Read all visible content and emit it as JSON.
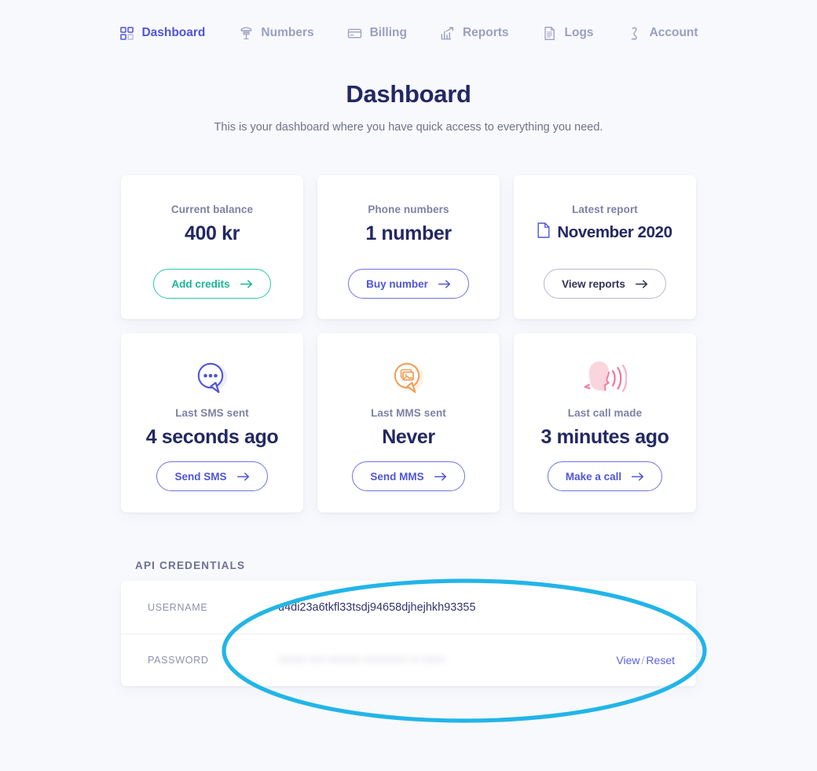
{
  "nav": {
    "items": [
      {
        "label": "Dashboard",
        "icon": "grid-icon",
        "active": true
      },
      {
        "label": "Numbers",
        "icon": "phone-icon",
        "active": false
      },
      {
        "label": "Billing",
        "icon": "card-icon",
        "active": false
      },
      {
        "label": "Reports",
        "icon": "chart-icon",
        "active": false
      },
      {
        "label": "Logs",
        "icon": "document-icon",
        "active": false
      },
      {
        "label": "Account",
        "icon": "person-icon",
        "active": false
      }
    ]
  },
  "header": {
    "title": "Dashboard",
    "subtitle": "This is your dashboard where you have quick access to everything you need."
  },
  "cards_row1": [
    {
      "label": "Current balance",
      "value": "400 kr",
      "button": "Add credits",
      "button_style": "green",
      "icon": null
    },
    {
      "label": "Phone numbers",
      "value": "1 number",
      "button": "Buy number",
      "button_style": "indigo",
      "icon": null
    },
    {
      "label": "Latest report",
      "value": "November 2020",
      "button": "View reports",
      "button_style": "grey",
      "icon": "file-icon"
    }
  ],
  "cards_row2": [
    {
      "illustration": "speech-bubble-dots-icon",
      "label": "Last SMS sent",
      "value": "4 seconds ago",
      "button": "Send SMS",
      "button_style": "indigo"
    },
    {
      "illustration": "speech-bubble-image-icon",
      "label": "Last MMS sent",
      "value": "Never",
      "button": "Send MMS",
      "button_style": "indigo"
    },
    {
      "illustration": "speaking-head-icon",
      "label": "Last call made",
      "value": "3 minutes ago",
      "button": "Make a call",
      "button_style": "indigo"
    }
  ],
  "credentials": {
    "section_title": "API CREDENTIALS",
    "username_label": "USERNAME",
    "username_value": "u4di23a6tkfl33tsdj94658djhejhkh93355",
    "password_label": "PASSWORD",
    "password_value": "••••••• •••• •••••••• ••••••••••• •• ••••••",
    "view_label": "View",
    "separator": "/",
    "reset_label": "Reset"
  },
  "colors": {
    "background": "#f8f9fd",
    "card": "#ffffff",
    "title": "#232863",
    "accent_indigo": "#4f55d9",
    "accent_green": "#18b894",
    "accent_orange": "#f0a05a",
    "accent_pink": "#f58ba8",
    "muted": "#7d81a3",
    "annotation": "#22b5e8"
  },
  "annotation": {
    "shape": "ellipse",
    "color": "#22b5e8"
  }
}
